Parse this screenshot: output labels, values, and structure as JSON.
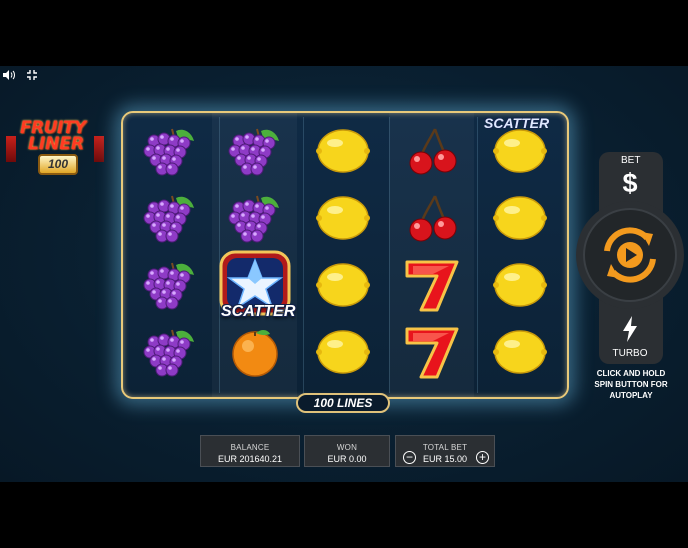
{
  "game": {
    "logo_line1": "FRUITY",
    "logo_line2": "LINER",
    "logo_badge": "100",
    "lines_label": "100 LINES",
    "scatter_label": "SCATTER",
    "scatter_partial": "SCATTER"
  },
  "reels": [
    [
      "grapes",
      "grapes",
      "grapes",
      "grapes"
    ],
    [
      "grapes",
      "grapes",
      "scatter-star",
      "orange"
    ],
    [
      "lemon",
      "lemon",
      "lemon",
      "lemon"
    ],
    [
      "cherries",
      "cherries",
      "seven",
      "seven"
    ],
    [
      "lemon",
      "lemon",
      "lemon",
      "lemon"
    ]
  ],
  "controls": {
    "bet_label": "BET",
    "bet_icon": "$",
    "spin_icon": "spin-icon",
    "turbo_label": "TURBO",
    "autoplay_hint": "CLICK AND HOLD SPIN BUTTON FOR AUTOPLAY"
  },
  "info": {
    "balance_label": "BALANCE",
    "balance_value": "EUR 201640.21",
    "won_label": "WON",
    "won_value": "EUR 0.00",
    "totalbet_label": "TOTAL BET",
    "totalbet_value": "EUR 15.00",
    "minus": "−",
    "plus": "+"
  },
  "colors": {
    "accent": "#f39a1e",
    "frame": "#e8c97a"
  }
}
